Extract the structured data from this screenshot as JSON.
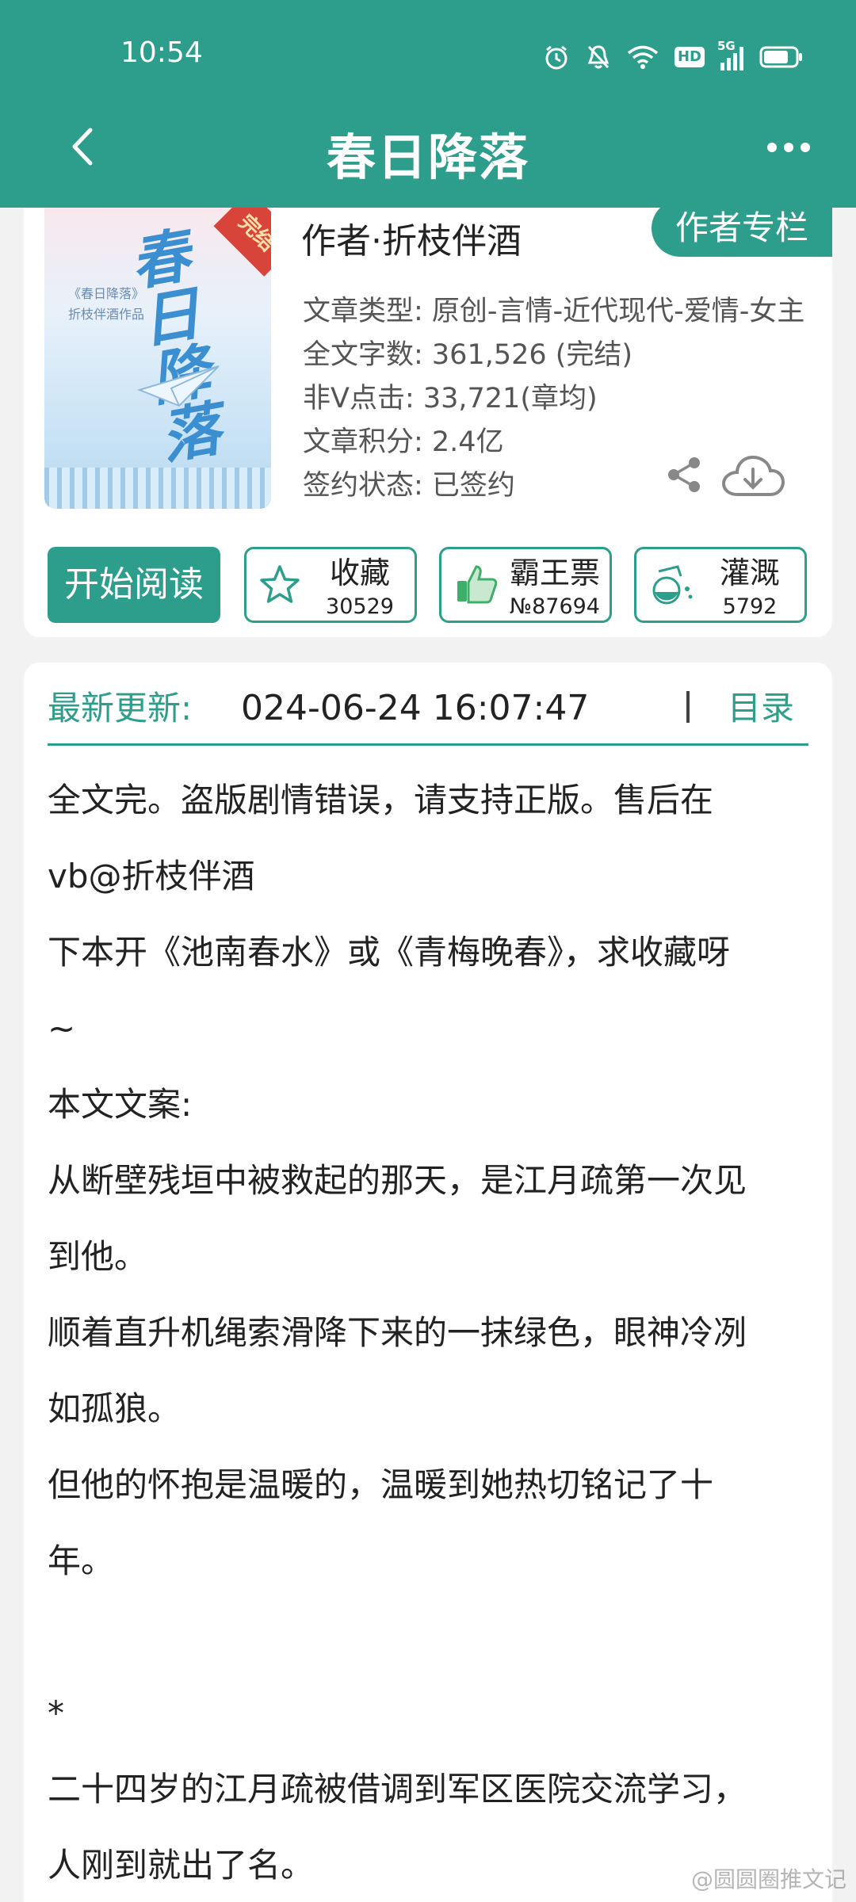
{
  "status_bar": {
    "time": "10:54",
    "network": "5G",
    "hd": "HD",
    "icons": [
      "alarm-icon",
      "mute-bell-icon",
      "wifi-icon",
      "hd-icon",
      "signal-icon",
      "battery-icon"
    ]
  },
  "header": {
    "title": "春日降落",
    "back_icon": "chevron-left-icon",
    "more_icon": "more-dots-icon"
  },
  "book": {
    "cover": {
      "title": "春日降落",
      "badge": "完结",
      "sub_lines": [
        "《春日降落》",
        "折枝伴酒作品"
      ]
    },
    "author": "作者·折枝伴酒",
    "author_column_label": "作者专栏",
    "meta": [
      "文章类型: 原创-言情-近代现代-爱情-女主",
      "全文字数: 361,526 (完结)",
      "非Ⅴ点击: 33,721(章均)",
      "文章积分: 2.4亿",
      "签约状态: 已签约"
    ],
    "share_icon": "share-icon",
    "download_icon": "cloud-download-icon"
  },
  "actions": {
    "start_reading": "开始阅读",
    "favorite": {
      "label": "收藏",
      "count": "30529",
      "icon": "star-icon"
    },
    "ticket": {
      "label": "霸王票",
      "count": "№87694",
      "icon": "thumbs-up-icon"
    },
    "water": {
      "label": "灌溉",
      "count": "5792",
      "icon": "flask-icon"
    }
  },
  "latest_update": {
    "label": "最新更新:",
    "time": "024-06-24 16:07:47",
    "toc_label": "目录"
  },
  "description_lines": [
    "全文完。盗版剧情错误，请支持正版。售后在",
    "vb@折枝伴酒",
    "下本开《池南春水》或《青梅晚春》，求收藏呀",
    "~",
    "本文文案:",
    "从断壁残垣中被救起的那天，是江月疏第一次见",
    "到他。",
    "顺着直升机绳索滑降下来的一抹绿色，眼神冷冽",
    "如孤狼。",
    "但他的怀抱是温暖的，温暖到她热切铭记了十",
    "年。",
    "",
    "*",
    "二十四岁的江月疏被借调到军区医院交流学习，",
    "人刚到就出了名。"
  ],
  "watermark": "@圆圆圈推文记",
  "colors": {
    "brand": "#2e9e8c",
    "background": "#f2f2f2",
    "card": "#ffffff",
    "text": "#222222",
    "meta_text": "#555555"
  }
}
